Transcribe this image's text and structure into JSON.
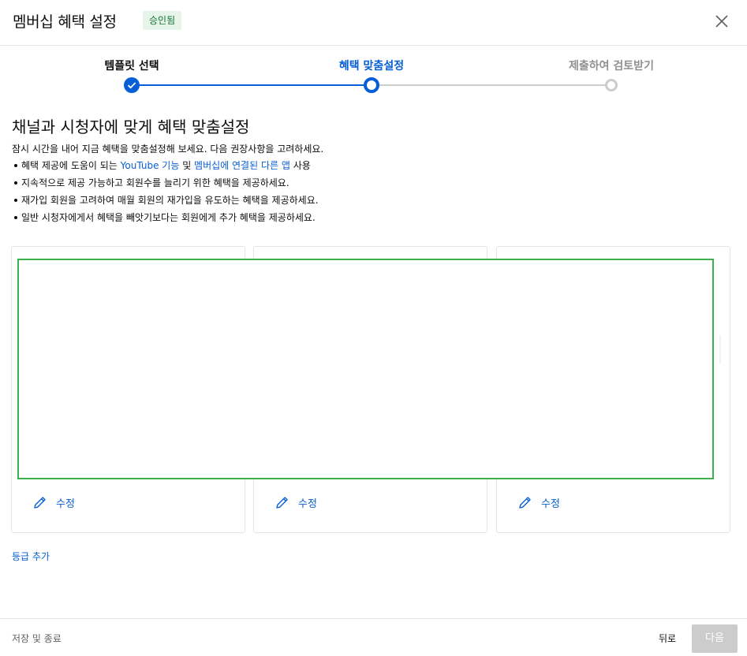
{
  "header": {
    "title": "멤버십 혜택 설정",
    "status_badge": "승인됨"
  },
  "stepper": {
    "steps": [
      {
        "label": "템플릿 선택",
        "state": "done"
      },
      {
        "label": "혜택 맞춤설정",
        "state": "current"
      },
      {
        "label": "제출하여 검토받기",
        "state": "upcoming"
      }
    ],
    "colors": {
      "active": "#065fd4",
      "inactive": "#cccccc"
    }
  },
  "main": {
    "heading": "채널과 시청자에 맞게 혜택 맞춤설정",
    "intro": "잠시 시간을 내어 지금 혜택을 맞춤설정해 보세요. 다음 권장사항을 고려하세요.",
    "bullet1": {
      "prefix": "혜택 제공에 도움이 되는 ",
      "link1": "YouTube 기능",
      "middle": " 및 ",
      "link2": "멤버십에 연결된 다른 앱",
      "suffix": " 사용"
    },
    "bullet2": "지속적으로 제공 가능하고 회원수를 늘리기 위한 혜택을 제공하세요.",
    "bullet3": "재가입 회원을 고려하여 매월 회원의 재가입을 유도하는 혜택을 제공하세요.",
    "bullet4": "일반 시청자에게서 혜택을 빼앗기보다는 회원에게 추가 혜택을 제공하세요."
  },
  "tiers": [
    {
      "edit_label": "수정",
      "icon": "pencil-icon"
    },
    {
      "edit_label": "수정",
      "icon": "pencil-icon"
    },
    {
      "edit_label": "수정",
      "icon": "pencil-icon"
    }
  ],
  "add_tier": "등급 추가",
  "footer": {
    "save_exit": "저장 및 종료",
    "back": "뒤로",
    "next": "다음"
  }
}
